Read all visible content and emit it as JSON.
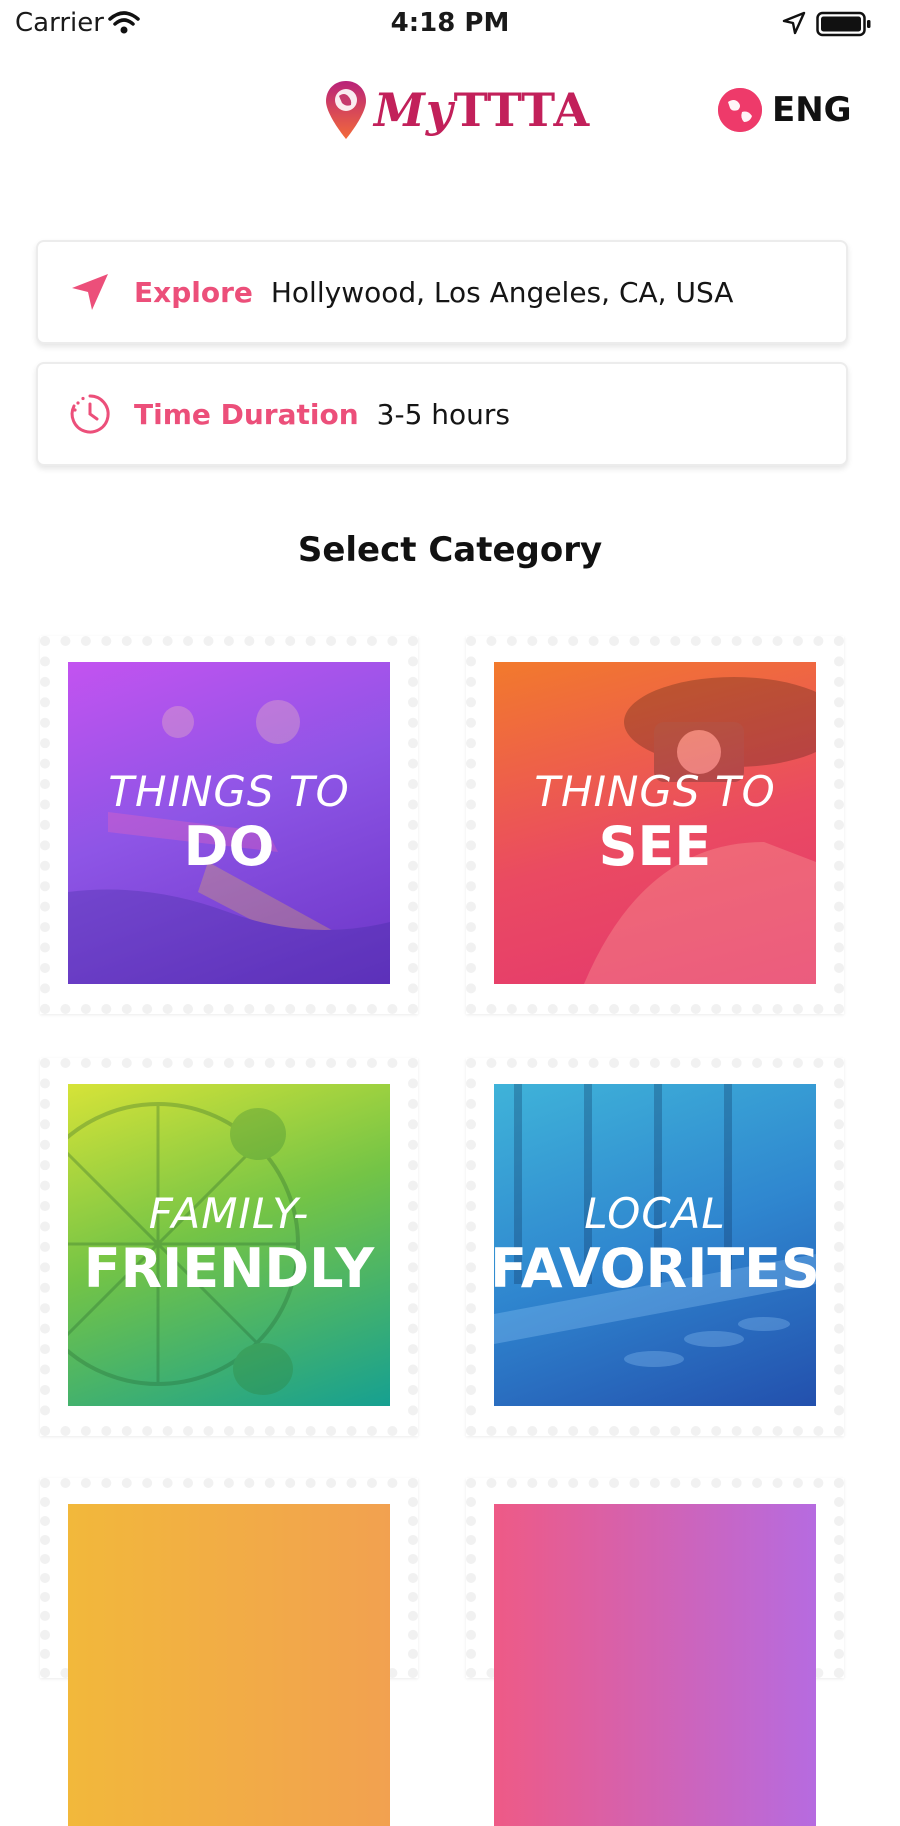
{
  "status_bar": {
    "carrier": "Carrier",
    "time": "4:18 PM"
  },
  "header": {
    "logo_prefix": "My",
    "logo_suffix": "TTTA",
    "language": "ENG"
  },
  "search": {
    "explore_label": "Explore",
    "explore_value": "Hollywood, Los Angeles, CA, USA",
    "duration_label": "Time Duration",
    "duration_value": "3-5 hours"
  },
  "section_title": "Select Category",
  "categories": [
    {
      "line1": "THINGS TO",
      "line2": "DO"
    },
    {
      "line1": "THINGS TO",
      "line2": "SEE"
    },
    {
      "line1": "FAMILY-",
      "line2": "FRIENDLY"
    },
    {
      "line1": "LOCAL",
      "line2": "FAVORITES"
    }
  ],
  "colors": {
    "accent": "#ec4f7a",
    "brand": "#c2205a"
  }
}
